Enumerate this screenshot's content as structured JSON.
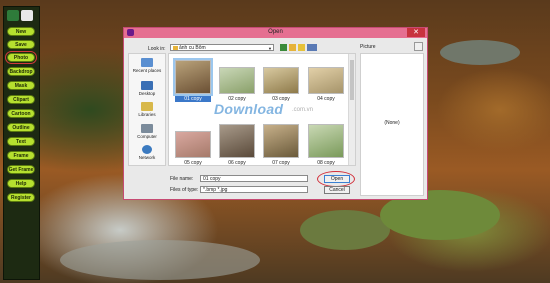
{
  "toolbar": {
    "buttons": [
      {
        "label": "New"
      },
      {
        "label": "Save"
      },
      {
        "label": "Photo"
      },
      {
        "label": "Backdrop"
      },
      {
        "label": "Mask"
      },
      {
        "label": "Clipart"
      },
      {
        "label": "Cartoon"
      },
      {
        "label": "Outline"
      },
      {
        "label": "Text"
      },
      {
        "label": "Frame"
      },
      {
        "label": "Get Frame"
      },
      {
        "label": "Help"
      },
      {
        "label": "Register"
      }
    ]
  },
  "dialog": {
    "title": "Open",
    "close_label": "✕",
    "look_in_label": "Look in:",
    "look_in_value": "ảnh cu Bôm",
    "places": [
      {
        "label": "Recent places"
      },
      {
        "label": "Desktop"
      },
      {
        "label": "Libraries"
      },
      {
        "label": "Computer"
      },
      {
        "label": "Network"
      }
    ],
    "files": [
      {
        "label": "01 copy",
        "selected": true
      },
      {
        "label": "02 copy"
      },
      {
        "label": "03 copy"
      },
      {
        "label": "04 copy"
      },
      {
        "label": "05 copy"
      },
      {
        "label": "06 copy"
      },
      {
        "label": "07 copy"
      },
      {
        "label": "08 copy"
      }
    ],
    "file_name_label": "File name:",
    "file_name_value": "01 copy",
    "file_type_label": "Files of type:",
    "file_type_value": "*.bmp *.jpg",
    "open_label": "Open",
    "cancel_label": "Cancel",
    "picture_label": "Picture",
    "picture_none": "(None)"
  },
  "watermark": {
    "text": "Download",
    "sub": ".com.vn"
  },
  "colors": {
    "accent": "#b6e02f",
    "titlebar": "#e56f91",
    "close": "#c8323e",
    "highlight_ring": "#d22f3a"
  }
}
